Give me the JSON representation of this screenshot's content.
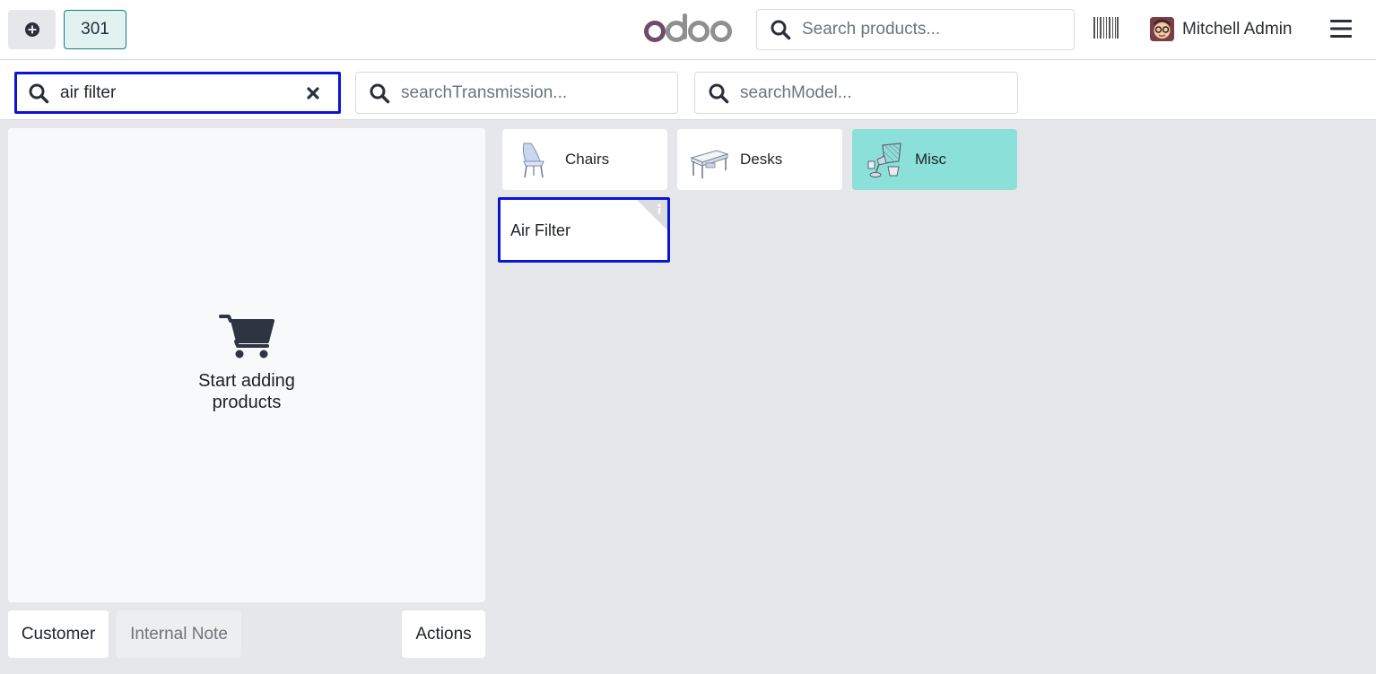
{
  "header": {
    "order_number": "301",
    "logo_text": "odoo",
    "search_placeholder": "Search products...",
    "user_name": "Mitchell Admin"
  },
  "filters": {
    "product_search_value": "air filter",
    "transmission_placeholder": "searchTransmission...",
    "model_placeholder": "searchModel..."
  },
  "order": {
    "empty_line1": "Start adding",
    "empty_line2": "products",
    "customer_label": "Customer",
    "note_label": "Internal Note",
    "actions_label": "Actions"
  },
  "categories": [
    {
      "label": "Chairs",
      "icon": "chair-icon"
    },
    {
      "label": "Desks",
      "icon": "desk-icon"
    },
    {
      "label": "Misc",
      "icon": "misc-icon",
      "selected": true
    }
  ],
  "products": [
    {
      "name": "Air Filter"
    }
  ],
  "colors": {
    "accent": "#0e7f79",
    "selected_category": "#8be0da",
    "focus_outline": "#0a14d8",
    "logo_purple": "#714b67",
    "logo_gray": "#8f8f8f"
  }
}
